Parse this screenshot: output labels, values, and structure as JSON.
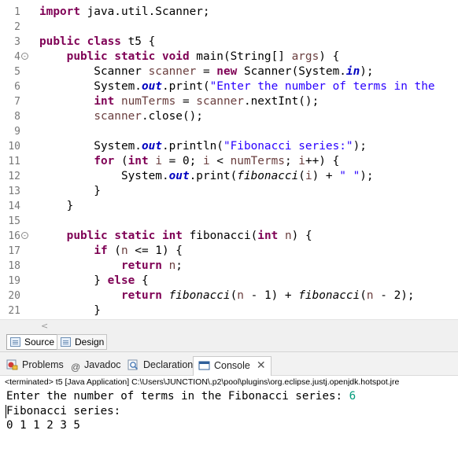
{
  "editor": {
    "lines": [
      {
        "num": "1",
        "fold": "",
        "segs": [
          {
            "t": "import",
            "c": "kw"
          },
          {
            "t": " java.util.Scanner;",
            "c": ""
          }
        ]
      },
      {
        "num": "2",
        "fold": "",
        "segs": []
      },
      {
        "num": "3",
        "fold": "",
        "segs": [
          {
            "t": "public",
            "c": "kw"
          },
          {
            "t": " ",
            "c": ""
          },
          {
            "t": "class",
            "c": "kw"
          },
          {
            "t": " t5 {",
            "c": ""
          }
        ]
      },
      {
        "num": "4",
        "fold": "-",
        "segs": [
          {
            "t": "    ",
            "c": ""
          },
          {
            "t": "public",
            "c": "kw"
          },
          {
            "t": " ",
            "c": ""
          },
          {
            "t": "static",
            "c": "kw"
          },
          {
            "t": " ",
            "c": ""
          },
          {
            "t": "void",
            "c": "kw"
          },
          {
            "t": " main(String[] ",
            "c": ""
          },
          {
            "t": "args",
            "c": "var"
          },
          {
            "t": ") {",
            "c": ""
          }
        ]
      },
      {
        "num": "5",
        "fold": "",
        "segs": [
          {
            "t": "        Scanner ",
            "c": ""
          },
          {
            "t": "scanner",
            "c": "var"
          },
          {
            "t": " = ",
            "c": ""
          },
          {
            "t": "new",
            "c": "kw"
          },
          {
            "t": " Scanner(System.",
            "c": ""
          },
          {
            "t": "in",
            "c": "fld"
          },
          {
            "t": ");",
            "c": ""
          }
        ]
      },
      {
        "num": "6",
        "fold": "",
        "segs": [
          {
            "t": "        System.",
            "c": ""
          },
          {
            "t": "out",
            "c": "fld"
          },
          {
            "t": ".print(",
            "c": ""
          },
          {
            "t": "\"Enter the number of terms in the",
            "c": "str"
          }
        ]
      },
      {
        "num": "7",
        "fold": "",
        "segs": [
          {
            "t": "        ",
            "c": ""
          },
          {
            "t": "int",
            "c": "kw"
          },
          {
            "t": " ",
            "c": ""
          },
          {
            "t": "numTerms",
            "c": "var"
          },
          {
            "t": " = ",
            "c": ""
          },
          {
            "t": "scanner",
            "c": "var"
          },
          {
            "t": ".nextInt();",
            "c": ""
          }
        ]
      },
      {
        "num": "8",
        "fold": "",
        "segs": [
          {
            "t": "        ",
            "c": ""
          },
          {
            "t": "scanner",
            "c": "var"
          },
          {
            "t": ".close();",
            "c": ""
          }
        ]
      },
      {
        "num": "9",
        "fold": "",
        "segs": []
      },
      {
        "num": "10",
        "fold": "",
        "segs": [
          {
            "t": "        System.",
            "c": ""
          },
          {
            "t": "out",
            "c": "fld"
          },
          {
            "t": ".println(",
            "c": ""
          },
          {
            "t": "\"Fibonacci series:\"",
            "c": "str"
          },
          {
            "t": ");",
            "c": ""
          }
        ]
      },
      {
        "num": "11",
        "fold": "",
        "segs": [
          {
            "t": "        ",
            "c": ""
          },
          {
            "t": "for",
            "c": "kw"
          },
          {
            "t": " (",
            "c": ""
          },
          {
            "t": "int",
            "c": "kw"
          },
          {
            "t": " ",
            "c": ""
          },
          {
            "t": "i",
            "c": "var"
          },
          {
            "t": " = 0; ",
            "c": ""
          },
          {
            "t": "i",
            "c": "var"
          },
          {
            "t": " < ",
            "c": ""
          },
          {
            "t": "numTerms",
            "c": "var"
          },
          {
            "t": "; ",
            "c": ""
          },
          {
            "t": "i",
            "c": "var"
          },
          {
            "t": "++) {",
            "c": ""
          }
        ]
      },
      {
        "num": "12",
        "fold": "",
        "segs": [
          {
            "t": "            System.",
            "c": ""
          },
          {
            "t": "out",
            "c": "fld"
          },
          {
            "t": ".print(",
            "c": ""
          },
          {
            "t": "fibonacci",
            "c": "mcall"
          },
          {
            "t": "(",
            "c": ""
          },
          {
            "t": "i",
            "c": "var"
          },
          {
            "t": ") + ",
            "c": ""
          },
          {
            "t": "\" \"",
            "c": "str"
          },
          {
            "t": ");",
            "c": ""
          }
        ]
      },
      {
        "num": "13",
        "fold": "",
        "segs": [
          {
            "t": "        }",
            "c": ""
          }
        ]
      },
      {
        "num": "14",
        "fold": "",
        "segs": [
          {
            "t": "    }",
            "c": ""
          }
        ]
      },
      {
        "num": "15",
        "fold": "",
        "segs": []
      },
      {
        "num": "16",
        "fold": "-",
        "segs": [
          {
            "t": "    ",
            "c": ""
          },
          {
            "t": "public",
            "c": "kw"
          },
          {
            "t": " ",
            "c": ""
          },
          {
            "t": "static",
            "c": "kw"
          },
          {
            "t": " ",
            "c": ""
          },
          {
            "t": "int",
            "c": "kw"
          },
          {
            "t": " fibonacci(",
            "c": ""
          },
          {
            "t": "int",
            "c": "kw"
          },
          {
            "t": " ",
            "c": ""
          },
          {
            "t": "n",
            "c": "var"
          },
          {
            "t": ") {",
            "c": ""
          }
        ]
      },
      {
        "num": "17",
        "fold": "",
        "segs": [
          {
            "t": "        ",
            "c": ""
          },
          {
            "t": "if",
            "c": "kw"
          },
          {
            "t": " (",
            "c": ""
          },
          {
            "t": "n",
            "c": "var"
          },
          {
            "t": " <= 1) {",
            "c": ""
          }
        ]
      },
      {
        "num": "18",
        "fold": "",
        "segs": [
          {
            "t": "            ",
            "c": ""
          },
          {
            "t": "return",
            "c": "kw"
          },
          {
            "t": " ",
            "c": ""
          },
          {
            "t": "n",
            "c": "var"
          },
          {
            "t": ";",
            "c": ""
          }
        ]
      },
      {
        "num": "19",
        "fold": "",
        "segs": [
          {
            "t": "        } ",
            "c": ""
          },
          {
            "t": "else",
            "c": "kw"
          },
          {
            "t": " {",
            "c": ""
          }
        ]
      },
      {
        "num": "20",
        "fold": "",
        "segs": [
          {
            "t": "            ",
            "c": ""
          },
          {
            "t": "return",
            "c": "kw"
          },
          {
            "t": " ",
            "c": ""
          },
          {
            "t": "fibonacci",
            "c": "mcall"
          },
          {
            "t": "(",
            "c": ""
          },
          {
            "t": "n",
            "c": "var"
          },
          {
            "t": " - 1) + ",
            "c": ""
          },
          {
            "t": "fibonacci",
            "c": "mcall"
          },
          {
            "t": "(",
            "c": ""
          },
          {
            "t": "n",
            "c": "var"
          },
          {
            "t": " - 2);",
            "c": ""
          }
        ]
      },
      {
        "num": "21",
        "fold": "",
        "segs": [
          {
            "t": "        }",
            "c": ""
          }
        ]
      }
    ],
    "scroll_left_arrow": "<"
  },
  "editor_tabs": {
    "source": "Source",
    "design": "Design"
  },
  "views": {
    "problems": "Problems",
    "javadoc": "Javadoc",
    "declaration": "Declaration",
    "console": "Console",
    "close_glyph": "✕"
  },
  "console": {
    "status": "<terminated> t5 [Java Application] C:\\Users\\JUNCTION\\.p2\\pool\\plugins\\org.eclipse.justj.openjdk.hotspot.jre",
    "prompt": "Enter the number of terms in the Fibonacci series: ",
    "user_input": "6",
    "line2": "Fibonacci series:",
    "line3": "0 1 1 2 3 5"
  },
  "colors": {
    "keyword": "#7f0055",
    "string": "#2a00ff",
    "field": "#0000c0",
    "local_var": "#6a3e3e",
    "user_input": "#009a7a"
  }
}
